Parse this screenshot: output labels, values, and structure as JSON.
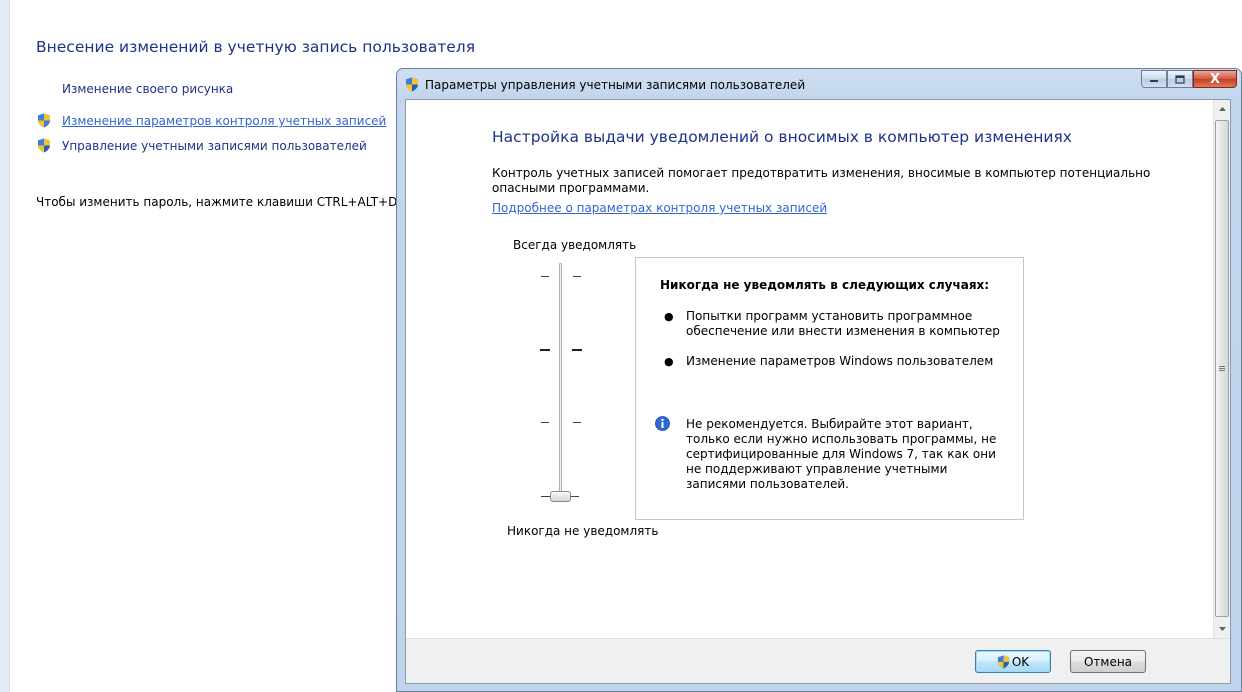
{
  "background": {
    "title": "Внесение изменений в учетную запись пользователя",
    "links": {
      "change_picture": "Изменение своего рисунка",
      "change_uac": "Изменение параметров контроля учетных записей",
      "manage_accounts": "Управление учетными записями пользователей"
    },
    "password_hint": "Чтобы изменить пароль, нажмите клавиши CTRL+ALT+DEL"
  },
  "dialog": {
    "title": "Параметры управления учетными записями пользователей",
    "caption_buttons": {
      "minimize": "minimize-icon",
      "maximize": "maximize-icon",
      "close": "X"
    },
    "heading": "Настройка выдачи уведомлений о вносимых в компьютер изменениях",
    "description": "Контроль учетных записей помогает предотвратить изменения, вносимые в компьютер потенциально опасными программами.",
    "more_link": "Подробнее о параметрах контроля учетных записей",
    "slider": {
      "top_label": "Всегда уведомлять",
      "bottom_label": "Никогда не уведомлять",
      "levels": 4,
      "selected_level": 1
    },
    "info": {
      "title": "Никогда не уведомлять в следующих случаях:",
      "bullets": [
        "Попытки программ установить программное обеспечение или внести изменения в компьютер",
        "Изменение параметров Windows пользователем"
      ],
      "note": "Не рекомендуется. Выбирайте этот вариант, только если нужно использовать программы, не сертифицированные для Windows 7, так как они не поддерживают управление учетными записями пользователей."
    },
    "buttons": {
      "ok": "OK",
      "cancel": "Отмена"
    }
  },
  "colors": {
    "link": "#1e3287",
    "hyperlink": "#3366cc",
    "frame": "#c3d6ec"
  }
}
